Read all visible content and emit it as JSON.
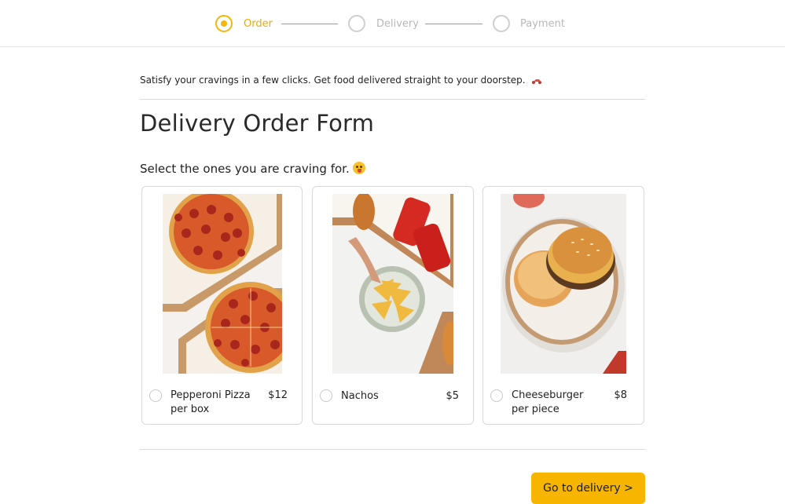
{
  "stepper": {
    "steps": [
      {
        "label": "Order",
        "state": "active"
      },
      {
        "label": "Delivery",
        "state": "inactive"
      },
      {
        "label": "Payment",
        "state": "inactive"
      }
    ]
  },
  "tagline": "Satisfy your cravings in a few clicks. Get food delivered straight to your doorstep.",
  "title": "Delivery Order Form",
  "subtitle": "Select the ones you are craving for.",
  "items": [
    {
      "name_line1": "Pepperoni Pizza",
      "name_line2": "per box",
      "price": "$12",
      "selected": false,
      "photo": "pepperoni-pizza-photo"
    },
    {
      "name_line1": "Nachos",
      "name_line2": "",
      "price": "$5",
      "selected": false,
      "photo": "nachos-photo"
    },
    {
      "name_line1": "Cheeseburger",
      "name_line2": "per piece",
      "price": "$8",
      "selected": false,
      "photo": "cheeseburger-photo"
    }
  ],
  "cta": {
    "label": "Go to delivery >"
  },
  "colors": {
    "accent": "#f5b50a",
    "button": "#f7b500",
    "inactive": "#cfcfcf"
  }
}
